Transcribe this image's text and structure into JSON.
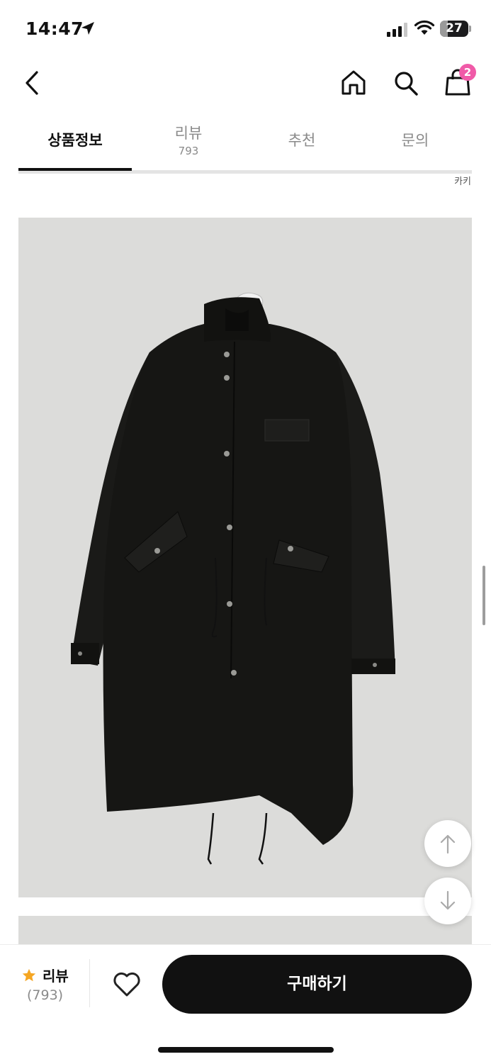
{
  "status_bar": {
    "time": "14:47",
    "battery": "27",
    "battery_level": 0.27
  },
  "nav": {
    "back_icon": "chevron-left-icon",
    "home_icon": "home-icon",
    "search_icon": "search-icon",
    "cart_icon": "shopping-bag-icon",
    "cart_badge": "2",
    "badge_color": "#f05aa8"
  },
  "tabs": [
    {
      "label": "상품정보",
      "count": ""
    },
    {
      "label": "리뷰",
      "count": "793"
    },
    {
      "label": "추천",
      "count": ""
    },
    {
      "label": "문의",
      "count": ""
    }
  ],
  "active_tab": 0,
  "content": {
    "color_caption": "카키",
    "image_background": "#dcdcda"
  },
  "floating": {
    "up_icon": "arrow-up-icon",
    "down_icon": "arrow-down-icon"
  },
  "bottom_bar": {
    "star_color": "#f5a623",
    "review_label": "리뷰",
    "review_count": "(793)",
    "wishlist_icon": "heart-icon",
    "buy_label": "구매하기"
  }
}
